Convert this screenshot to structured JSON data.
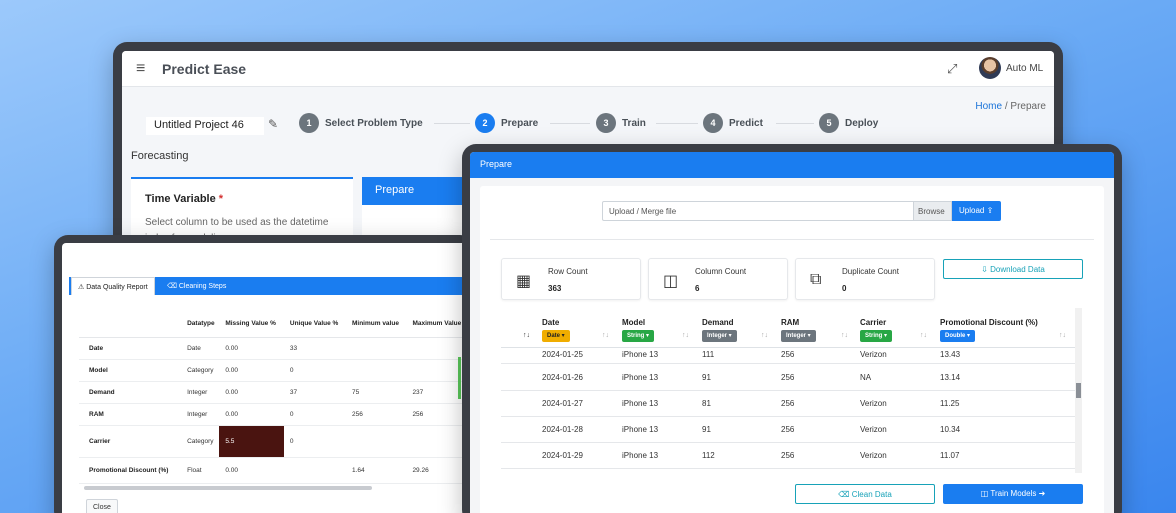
{
  "app": {
    "brand": "Predict Ease",
    "user_label": "Auto ML",
    "breadcrumb": {
      "home": "Home",
      "separator": "/",
      "current": "Prepare"
    },
    "project_name": "Untitled Project 46",
    "steps": [
      {
        "num": "1",
        "label": "Select Problem Type"
      },
      {
        "num": "2",
        "label": "Prepare"
      },
      {
        "num": "3",
        "label": "Train"
      },
      {
        "num": "4",
        "label": "Predict"
      },
      {
        "num": "5",
        "label": "Deploy"
      }
    ],
    "active_step": 2,
    "section_title": "Forecasting",
    "time_variable": {
      "title": "Time Variable",
      "required_mark": "*",
      "desc": "Select column to be used as the datetime index for modeling"
    },
    "prepare_panel_title": "Prepare"
  },
  "quality": {
    "tabs": [
      "Data Quality Report",
      "Cleaning Steps"
    ],
    "headers": [
      "",
      "Datatype",
      "Missing Value %",
      "Unique Value %",
      "Minimum value",
      "Maximum Value"
    ],
    "rows": [
      [
        "Date",
        "Date",
        "0.00",
        "33",
        "",
        ""
      ],
      [
        "Model",
        "Category",
        "0.00",
        "0",
        "",
        ""
      ],
      [
        "Demand",
        "Integer",
        "0.00",
        "37",
        "75",
        "237"
      ],
      [
        "RAM",
        "Integer",
        "0.00",
        "0",
        "256",
        "256"
      ],
      [
        "Carrier",
        "Category",
        "5.5",
        "0",
        "",
        ""
      ],
      [
        "Promotional Discount (%)",
        "Float",
        "0.00",
        "",
        "1.64",
        "29.26"
      ]
    ],
    "close_label": "Close"
  },
  "prepare_modal": {
    "title": "Prepare",
    "upload_placeholder": "Upload / Merge file",
    "browse_label": "Browse",
    "upload_label": "Upload",
    "stats": [
      {
        "label": "Row Count",
        "value": "363",
        "icon": "table-icon"
      },
      {
        "label": "Column Count",
        "value": "6",
        "icon": "columns-icon"
      },
      {
        "label": "Duplicate Count",
        "value": "0",
        "icon": "copy-icon"
      }
    ],
    "download_label": "Download Data",
    "columns": [
      {
        "name": "Date",
        "type": "Date",
        "color": "#f0ad00"
      },
      {
        "name": "Model",
        "type": "String",
        "color": "#28a745"
      },
      {
        "name": "Demand",
        "type": "Integer",
        "color": "#6c757d"
      },
      {
        "name": "RAM",
        "type": "Integer",
        "color": "#6c757d"
      },
      {
        "name": "Carrier",
        "type": "String",
        "color": "#28a745"
      },
      {
        "name": "Promotional Discount (%)",
        "type": "Double",
        "color": "#1a7df0"
      }
    ],
    "rows": [
      [
        "2024-01-25",
        "iPhone 13",
        "111",
        "256",
        "Verizon",
        "13.43"
      ],
      [
        "2024-01-26",
        "iPhone 13",
        "91",
        "256",
        "NA",
        "13.14"
      ],
      [
        "2024-01-27",
        "iPhone 13",
        "81",
        "256",
        "Verizon",
        "11.25"
      ],
      [
        "2024-01-28",
        "iPhone 13",
        "91",
        "256",
        "Verizon",
        "10.34"
      ],
      [
        "2024-01-29",
        "iPhone 13",
        "112",
        "256",
        "Verizon",
        "11.07"
      ]
    ],
    "clean_label": "Clean Data",
    "train_label": "Train Models"
  }
}
